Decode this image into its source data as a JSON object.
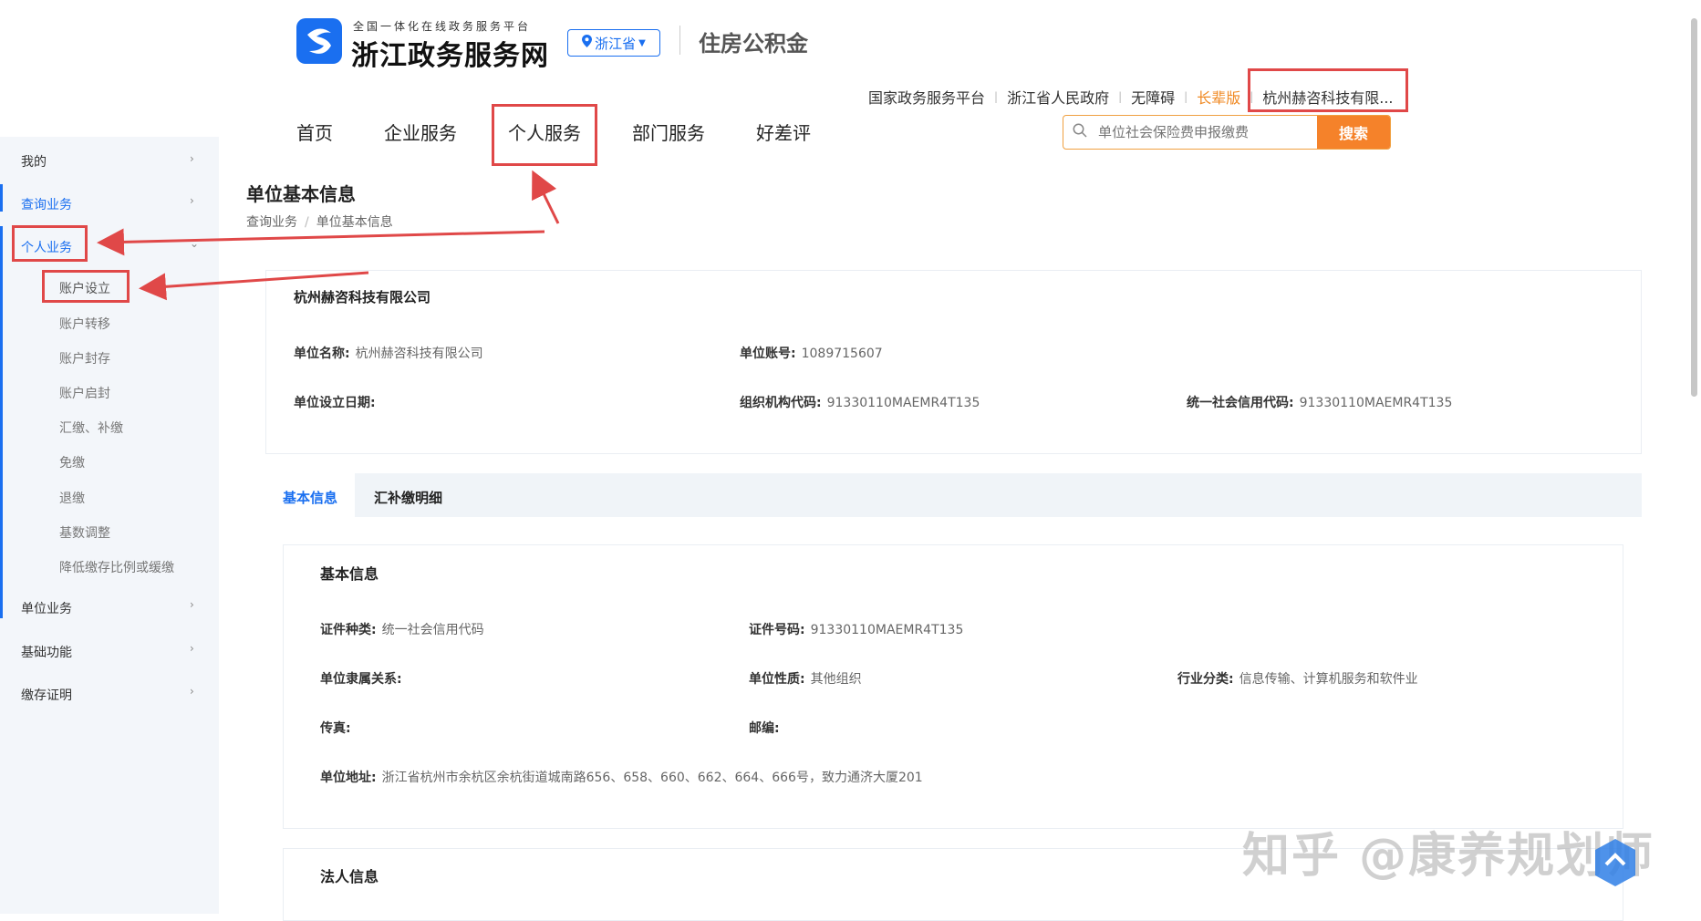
{
  "header": {
    "logo_subtitle": "全国一体化在线政务服务平台",
    "logo_title": "浙江政务服务网",
    "province": "浙江省",
    "section": "住房公积金"
  },
  "toplinks": {
    "national": "国家政务服务平台",
    "province_gov": "浙江省人民政府",
    "accessible": "无障碍",
    "elder": "长辈版",
    "user": "杭州赫咨科技有限..."
  },
  "nav": [
    "首页",
    "企业服务",
    "个人服务",
    "部门服务",
    "好差评"
  ],
  "search": {
    "placeholder": "单位社会保险费申报缴费",
    "button": "搜索"
  },
  "sidebar": {
    "mine": "我的",
    "query": "查询业务",
    "personal": "个人业务",
    "personal_items": [
      "账户设立",
      "账户转移",
      "账户封存",
      "账户启封",
      "汇缴、补缴",
      "免缴",
      "退缴",
      "基数调整",
      "降低缴存比例或缓缴"
    ],
    "unit": "单位业务",
    "basic": "基础功能",
    "proof": "缴存证明"
  },
  "page": {
    "title": "单位基本信息",
    "breadcrumb": [
      "查询业务",
      "单位基本信息"
    ],
    "company": "杭州赫咨科技有限公司",
    "fields": {
      "unit_name_label": "单位名称:",
      "unit_name": "杭州赫咨科技有限公司",
      "unit_account_label": "单位账号:",
      "unit_account": "1089715607",
      "setup_date_label": "单位设立日期:",
      "setup_date": "",
      "org_code_label": "组织机构代码:",
      "org_code": "91330110MAEMR4T135",
      "credit_code_label": "统一社会信用代码:",
      "credit_code": "91330110MAEMR4T135"
    },
    "tabs": [
      "基本信息",
      "汇补缴明细"
    ],
    "basic_info": {
      "title": "基本信息",
      "cert_type_label": "证件种类:",
      "cert_type": "统一社会信用代码",
      "cert_no_label": "证件号码:",
      "cert_no": "91330110MAEMR4T135",
      "affiliation_label": "单位隶属关系:",
      "affiliation": "",
      "nature_label": "单位性质:",
      "nature": "其他组织",
      "industry_label": "行业分类:",
      "industry": "信息传输、计算机服务和软件业",
      "fax_label": "传真:",
      "fax": "",
      "postcode_label": "邮编:",
      "postcode": "",
      "address_label": "单位地址:",
      "address": "浙江省杭州市余杭区余杭街道城南路656、658、660、662、664、666号，致力通济大厦201"
    },
    "legal_title": "法人信息"
  },
  "watermark": "知乎 @康养规划师",
  "colors": {
    "brand_blue": "#1a6ff0",
    "search_orange": "#f5822a",
    "annotation_red": "#e04848"
  }
}
